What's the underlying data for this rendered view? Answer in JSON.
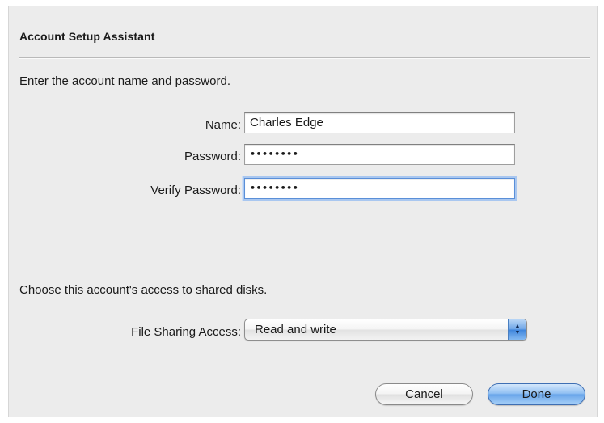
{
  "dialog": {
    "title": "Account Setup Assistant",
    "prompt_account": "Enter the account name and password.",
    "prompt_access": "Choose this account's access to shared disks."
  },
  "form": {
    "name_label": "Name:",
    "name_value": "Charles Edge",
    "password_label": "Password:",
    "password_value": "••••••••",
    "verify_label": "Verify Password:",
    "verify_value": "••••••••",
    "file_sharing_label": "File Sharing Access:",
    "file_sharing_selected": "Read and write"
  },
  "buttons": {
    "cancel": "Cancel",
    "done": "Done"
  },
  "icons": {
    "popup_arrows": "up-down-chevron-icon"
  },
  "colors": {
    "focus_ring": "#5a8fd8",
    "default_button": "#6aa6ea"
  }
}
